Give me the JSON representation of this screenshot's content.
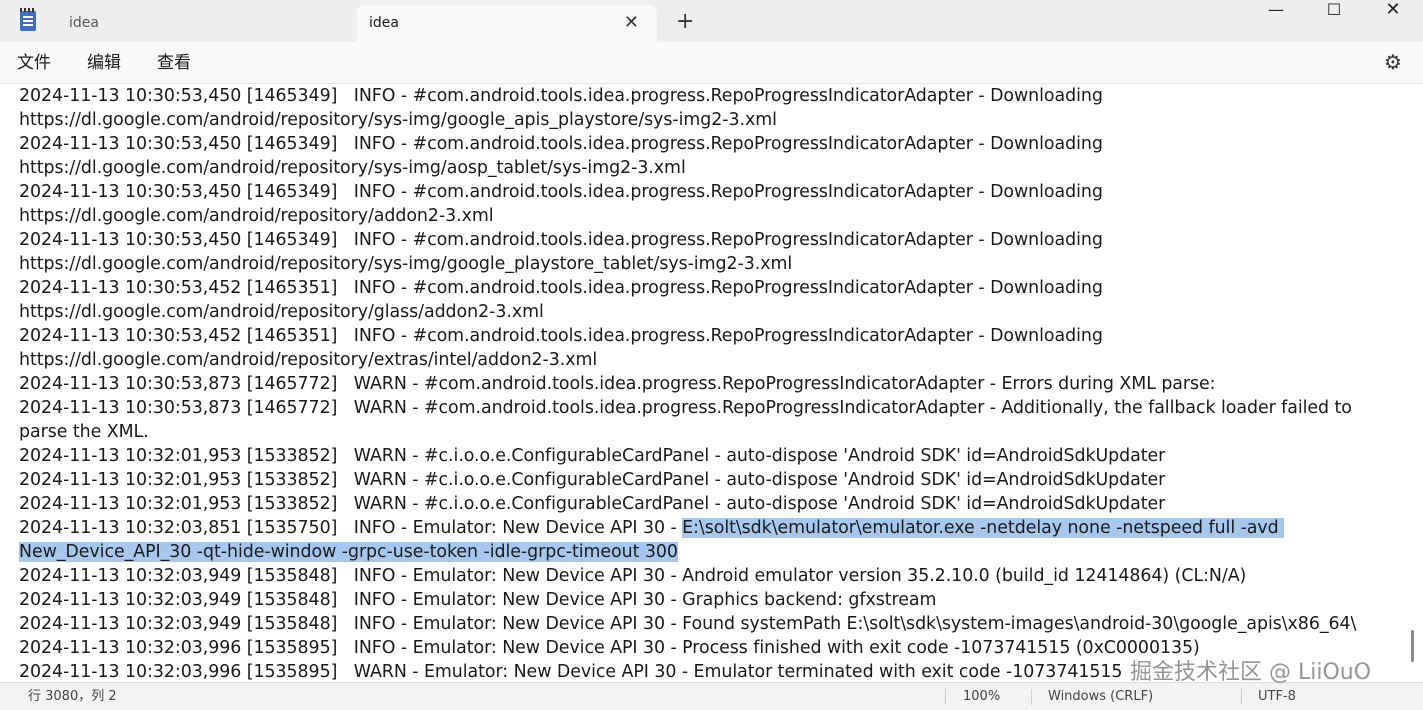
{
  "tabs": {
    "inactive_title": "idea",
    "active_title": "idea",
    "close_glyph": "✕",
    "add_glyph": "+"
  },
  "window_controls": {
    "minimize": "—",
    "maximize": "☐",
    "close": "✕"
  },
  "menu": {
    "file": "文件",
    "edit": "编辑",
    "view": "查看"
  },
  "settings_icon": "gear-icon",
  "log_lines": [
    "2024-11-13 10:30:53,450 [1465349]   INFO - #com.android.tools.idea.progress.RepoProgressIndicatorAdapter - Downloading",
    "https://dl.google.com/android/repository/sys-img/google_apis_playstore/sys-img2-3.xml",
    "2024-11-13 10:30:53,450 [1465349]   INFO - #com.android.tools.idea.progress.RepoProgressIndicatorAdapter - Downloading",
    "https://dl.google.com/android/repository/sys-img/aosp_tablet/sys-img2-3.xml",
    "2024-11-13 10:30:53,450 [1465349]   INFO - #com.android.tools.idea.progress.RepoProgressIndicatorAdapter - Downloading",
    "https://dl.google.com/android/repository/addon2-3.xml",
    "2024-11-13 10:30:53,450 [1465349]   INFO - #com.android.tools.idea.progress.RepoProgressIndicatorAdapter - Downloading",
    "https://dl.google.com/android/repository/sys-img/google_playstore_tablet/sys-img2-3.xml",
    "2024-11-13 10:30:53,452 [1465351]   INFO - #com.android.tools.idea.progress.RepoProgressIndicatorAdapter - Downloading",
    "https://dl.google.com/android/repository/glass/addon2-3.xml",
    "2024-11-13 10:30:53,452 [1465351]   INFO - #com.android.tools.idea.progress.RepoProgressIndicatorAdapter - Downloading",
    "https://dl.google.com/android/repository/extras/intel/addon2-3.xml",
    "2024-11-13 10:30:53,873 [1465772]   WARN - #com.android.tools.idea.progress.RepoProgressIndicatorAdapter - Errors during XML parse:",
    "2024-11-13 10:30:53,873 [1465772]   WARN - #com.android.tools.idea.progress.RepoProgressIndicatorAdapter - Additionally, the fallback loader failed to",
    "parse the XML.",
    "2024-11-13 10:32:01,953 [1533852]   WARN - #c.i.o.o.e.ConfigurableCardPanel - auto-dispose 'Android SDK' id=AndroidSdkUpdater",
    "2024-11-13 10:32:01,953 [1533852]   WARN - #c.i.o.o.e.ConfigurableCardPanel - auto-dispose 'Android SDK' id=AndroidSdkUpdater",
    "2024-11-13 10:32:01,953 [1533852]   WARN - #c.i.o.o.e.ConfigurableCardPanel - auto-dispose 'Android SDK' id=AndroidSdkUpdater"
  ],
  "selected_line": {
    "prefix": "2024-11-13 10:32:03,851 [1535750]   INFO - Emulator: New Device API 30 - ",
    "selected_part1": "E:\\solt\\sdk\\emulator\\emulator.exe -netdelay none -netspeed full -avd ",
    "selected_part2": "New_Device_API_30 -qt-hide-window -grpc-use-token -idle-grpc-timeout 300"
  },
  "log_lines_after": [
    "2024-11-13 10:32:03,949 [1535848]   INFO - Emulator: New Device API 30 - Android emulator version 35.2.10.0 (build_id 12414864) (CL:N/A)",
    "2024-11-13 10:32:03,949 [1535848]   INFO - Emulator: New Device API 30 - Graphics backend: gfxstream",
    "2024-11-13 10:32:03,949 [1535848]   INFO - Emulator: New Device API 30 - Found systemPath E:\\solt\\sdk\\system-images\\android-30\\google_apis\\x86_64\\",
    "2024-11-13 10:32:03,996 [1535895]   INFO - Emulator: New Device API 30 - Process finished with exit code -1073741515 (0xC0000135)",
    "2024-11-13 10:32:03,996 [1535895]   WARN - Emulator: New Device API 30 - Emulator terminated with exit code -1073741515"
  ],
  "status": {
    "position": "行 3080，列 2",
    "zoom": "100%",
    "line_ending": "Windows (CRLF)",
    "encoding": "UTF-8"
  },
  "watermark": "掘金技术社区 @ LiiOuO",
  "colors": {
    "selection": "#a6c8ee",
    "tabbar": "#eeeeee",
    "editor_bg": "#ffffff"
  }
}
